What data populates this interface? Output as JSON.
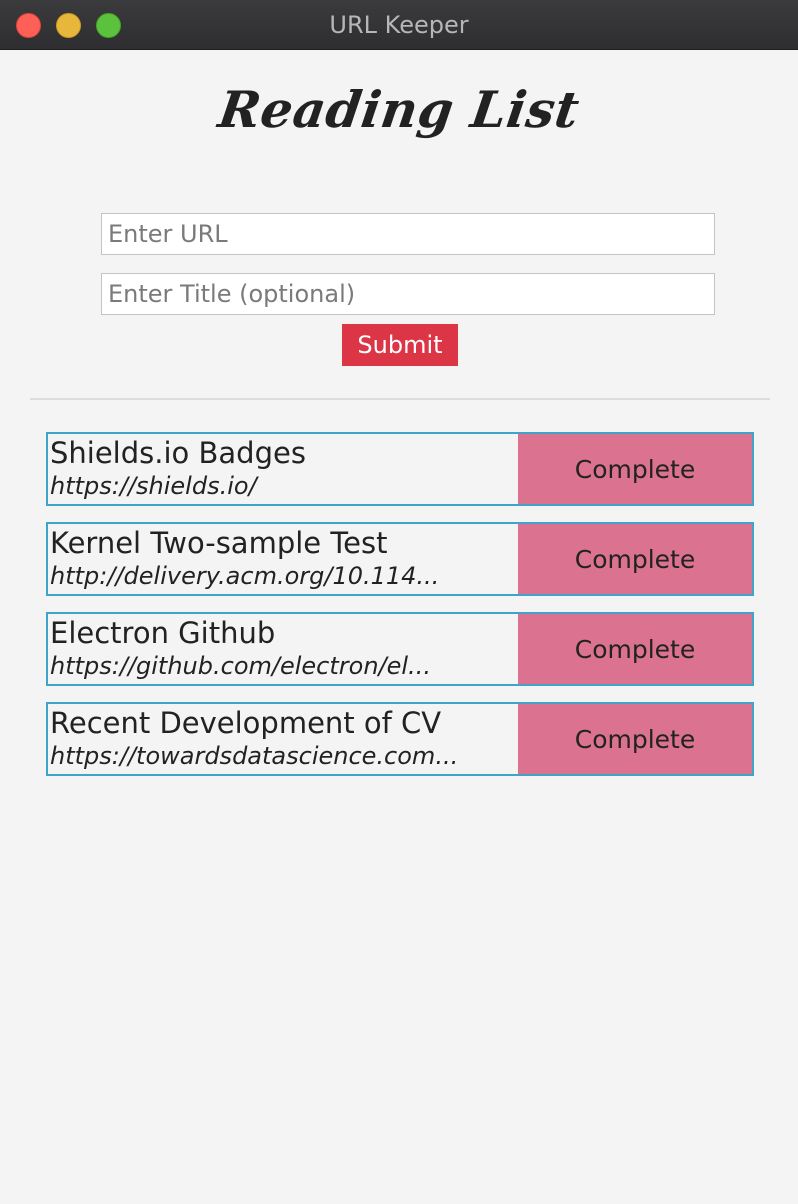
{
  "window": {
    "title": "URL Keeper"
  },
  "heading": "Reading List",
  "form": {
    "url_placeholder": "Enter URL",
    "title_placeholder": "Enter Title (optional)",
    "submit_label": "Submit"
  },
  "items": [
    {
      "title": "Shields.io Badges",
      "url": "https://shields.io/",
      "action": "Complete"
    },
    {
      "title": "Kernel Two-sample Test",
      "url": "http://delivery.acm.org/10.114...",
      "action": "Complete"
    },
    {
      "title": "Electron Github",
      "url": "https://github.com/electron/el...",
      "action": "Complete"
    },
    {
      "title": "Recent Development of CV",
      "url": "https://towardsdatascience.com...",
      "action": "Complete"
    }
  ],
  "colors": {
    "submit": "#dc3545",
    "complete": "#db7290",
    "item_border": "#3fa4c9"
  }
}
